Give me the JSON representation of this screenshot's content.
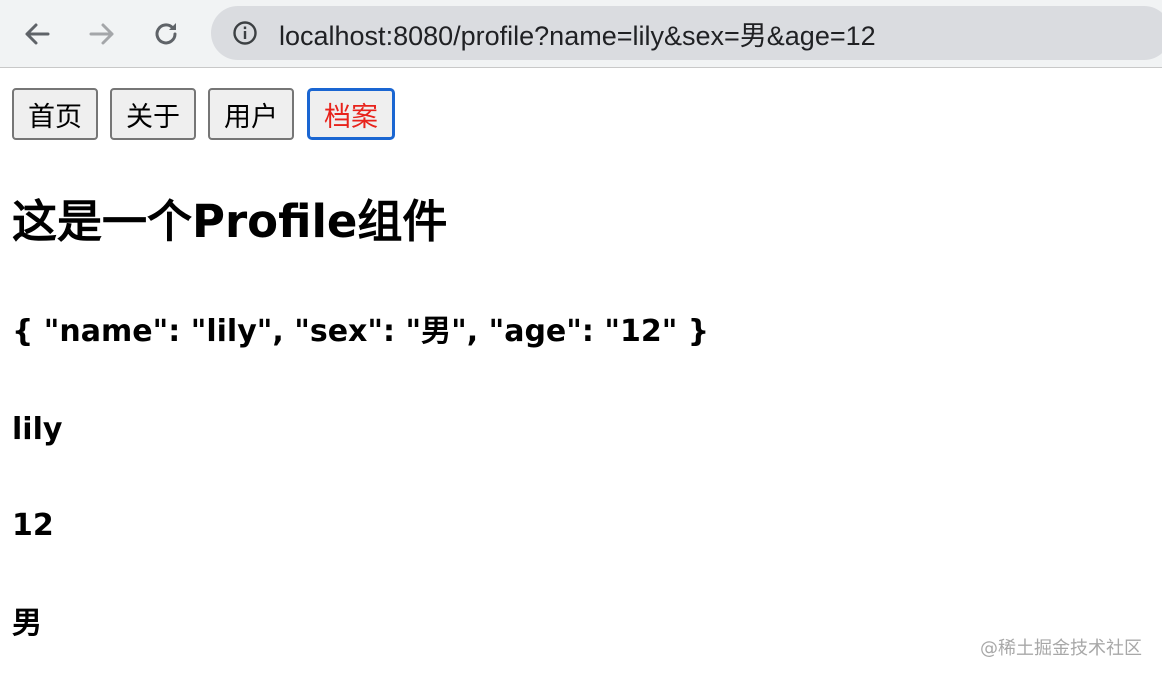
{
  "browser": {
    "url": "localhost:8080/profile?name=lily&sex=男&age=12",
    "icons": {
      "back": "arrow-left-icon",
      "forward": "arrow-right-icon",
      "reload": "reload-icon",
      "site_info": "info-circle-icon"
    }
  },
  "router_nav": {
    "items": [
      {
        "label": "首页",
        "active": false
      },
      {
        "label": "关于",
        "active": false
      },
      {
        "label": "用户",
        "active": false
      },
      {
        "label": "档案",
        "active": true
      }
    ],
    "active_text_color": "#e8221b",
    "active_border_color": "#1a66d2"
  },
  "profile": {
    "heading": "这是一个Profile组件",
    "query_json": "{ \"name\": \"lily\", \"sex\": \"男\", \"age\": \"12\" }",
    "name": "lily",
    "age": "12",
    "sex": "男"
  },
  "watermark": "@稀土掘金技术社区"
}
